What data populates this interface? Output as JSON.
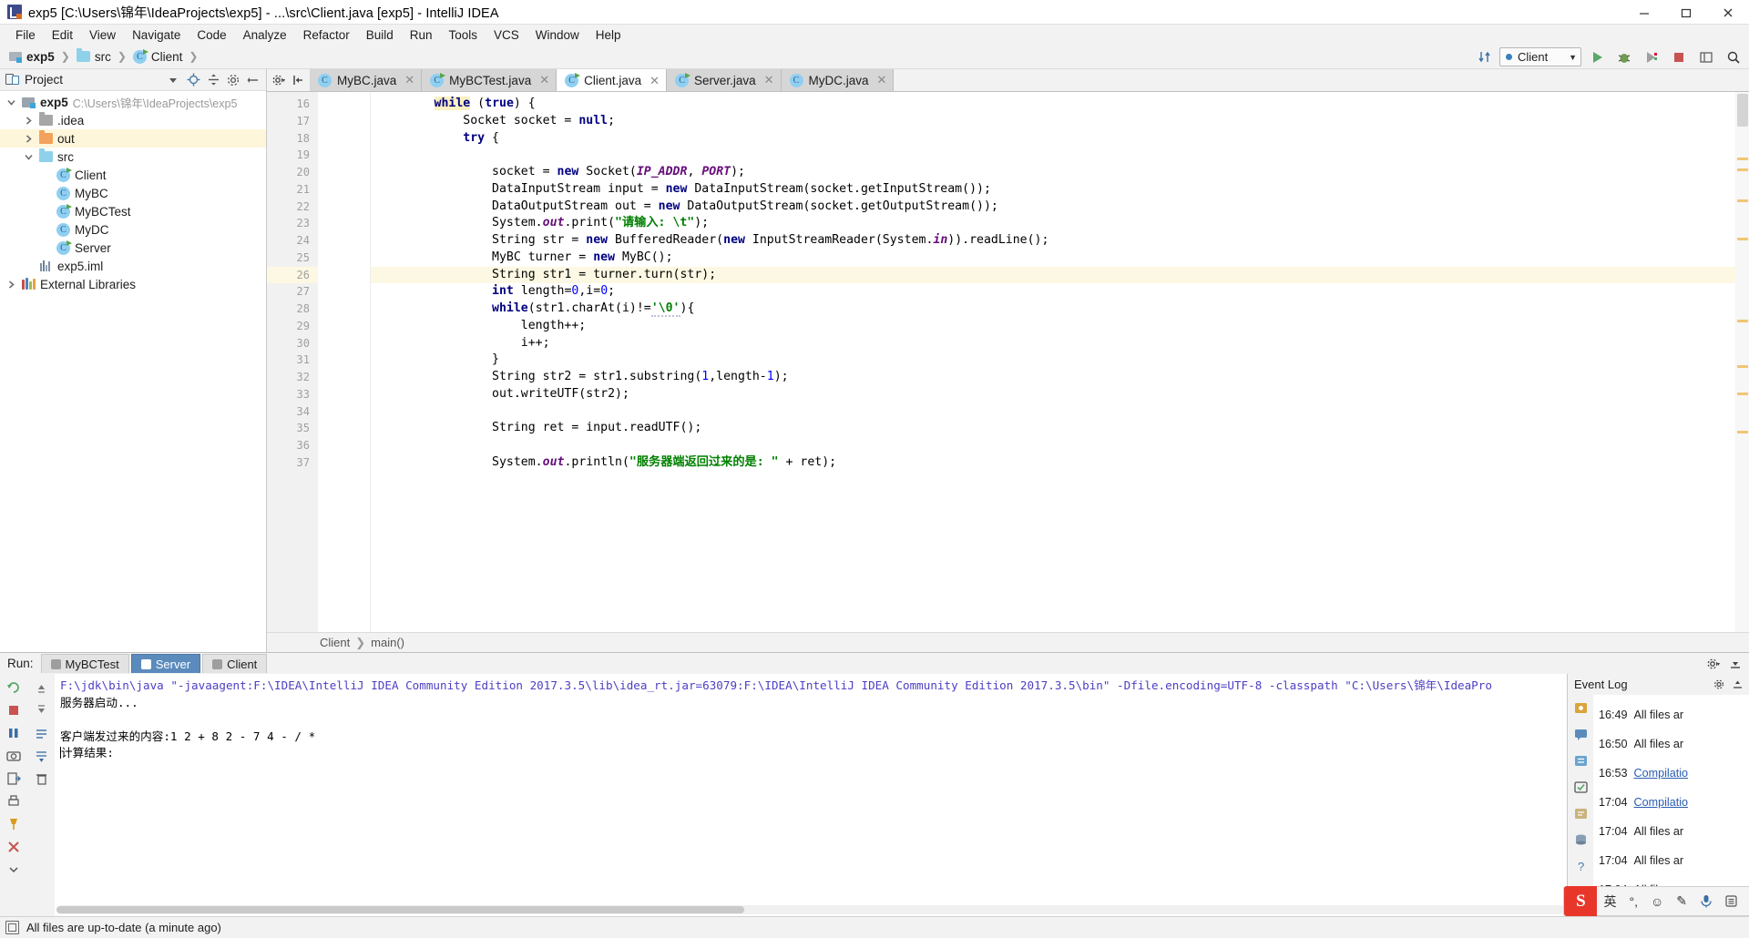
{
  "window": {
    "title": "exp5 [C:\\Users\\锦年\\IdeaProjects\\exp5] - ...\\src\\Client.java [exp5] - IntelliJ IDEA",
    "minimize_label": "Minimize",
    "maximize_label": "Maximize",
    "close_label": "Close"
  },
  "menubar": {
    "items": [
      {
        "label": "File"
      },
      {
        "label": "Edit"
      },
      {
        "label": "View"
      },
      {
        "label": "Navigate"
      },
      {
        "label": "Code"
      },
      {
        "label": "Analyze"
      },
      {
        "label": "Refactor"
      },
      {
        "label": "Build"
      },
      {
        "label": "Run"
      },
      {
        "label": "Tools"
      },
      {
        "label": "VCS"
      },
      {
        "label": "Window"
      },
      {
        "label": "Help"
      }
    ]
  },
  "navbar": {
    "crumbs": [
      {
        "label": "exp5",
        "icon": "module-icon"
      },
      {
        "label": "src",
        "icon": "folder-icon"
      },
      {
        "label": "Client",
        "icon": "java-class-icon"
      }
    ],
    "run_config": "Client",
    "run_tooltip": "Run",
    "debug_tooltip": "Debug",
    "coverage_tooltip": "Run with Coverage",
    "stop_tooltip": "Stop",
    "sync_tooltip": "Synchronize",
    "search_tooltip": "Search Everywhere"
  },
  "project_panel": {
    "title": "Project",
    "tree": [
      {
        "label": "exp5",
        "secondary": "C:\\Users\\锦年\\IdeaProjects\\exp5",
        "icon": "module-icon",
        "arrow": "down",
        "indent": 0,
        "bold": true,
        "selected": false
      },
      {
        "label": ".idea",
        "secondary": "",
        "icon": "folder-gray-icon",
        "arrow": "right",
        "indent": 1,
        "bold": false,
        "selected": false
      },
      {
        "label": "out",
        "secondary": "",
        "icon": "folder-orange-icon",
        "arrow": "right",
        "indent": 1,
        "bold": false,
        "selected": true
      },
      {
        "label": "src",
        "secondary": "",
        "icon": "folder-blue-icon",
        "arrow": "down",
        "indent": 1,
        "bold": false,
        "selected": false
      },
      {
        "label": "Client",
        "secondary": "",
        "icon": "java-class-runnable-icon",
        "arrow": "none",
        "indent": 2,
        "bold": false,
        "selected": false
      },
      {
        "label": "MyBC",
        "secondary": "",
        "icon": "java-class-icon",
        "arrow": "none",
        "indent": 2,
        "bold": false,
        "selected": false
      },
      {
        "label": "MyBCTest",
        "secondary": "",
        "icon": "java-class-runnable-icon",
        "arrow": "none",
        "indent": 2,
        "bold": false,
        "selected": false
      },
      {
        "label": "MyDC",
        "secondary": "",
        "icon": "java-class-icon",
        "arrow": "none",
        "indent": 2,
        "bold": false,
        "selected": false
      },
      {
        "label": "Server",
        "secondary": "",
        "icon": "java-class-runnable-icon",
        "arrow": "none",
        "indent": 2,
        "bold": false,
        "selected": false
      },
      {
        "label": "exp5.iml",
        "secondary": "",
        "icon": "iml-file-icon",
        "arrow": "none",
        "indent": 1,
        "bold": false,
        "selected": false
      },
      {
        "label": "External Libraries",
        "secondary": "",
        "icon": "library-icon",
        "arrow": "right",
        "indent": 0,
        "bold": false,
        "selected": false
      }
    ]
  },
  "editor": {
    "tabs": [
      {
        "label": "MyBC.java",
        "icon": "java-class-icon",
        "active": false
      },
      {
        "label": "MyBCTest.java",
        "icon": "java-class-runnable-icon",
        "active": false
      },
      {
        "label": "Client.java",
        "icon": "java-class-runnable-icon",
        "active": true
      },
      {
        "label": "Server.java",
        "icon": "java-class-runnable-icon",
        "active": false
      },
      {
        "label": "MyDC.java",
        "icon": "java-class-icon",
        "active": false
      }
    ],
    "first_line_number": 16,
    "current_line": 26,
    "lines": [
      {
        "n": 16,
        "tokens": [
          {
            "t": "        ",
            "c": ""
          },
          {
            "t": "while",
            "c": "kw hl"
          },
          {
            "t": " (",
            "c": ""
          },
          {
            "t": "true",
            "c": "kw"
          },
          {
            "t": ") {",
            "c": ""
          }
        ]
      },
      {
        "n": 17,
        "tokens": [
          {
            "t": "            Socket socket = ",
            "c": ""
          },
          {
            "t": "null",
            "c": "kw"
          },
          {
            "t": ";",
            "c": ""
          }
        ]
      },
      {
        "n": 18,
        "tokens": [
          {
            "t": "            ",
            "c": ""
          },
          {
            "t": "try",
            "c": "kw"
          },
          {
            "t": " {",
            "c": ""
          }
        ]
      },
      {
        "n": 19,
        "tokens": []
      },
      {
        "n": 20,
        "tokens": [
          {
            "t": "                socket = ",
            "c": ""
          },
          {
            "t": "new",
            "c": "kw"
          },
          {
            "t": " Socket(",
            "c": ""
          },
          {
            "t": "IP_ADDR",
            "c": "field"
          },
          {
            "t": ", ",
            "c": ""
          },
          {
            "t": "PORT",
            "c": "field"
          },
          {
            "t": ");",
            "c": ""
          }
        ]
      },
      {
        "n": 21,
        "tokens": [
          {
            "t": "                DataInputStream input = ",
            "c": ""
          },
          {
            "t": "new",
            "c": "kw"
          },
          {
            "t": " DataInputStream(socket.getInputStream());",
            "c": ""
          }
        ]
      },
      {
        "n": 22,
        "tokens": [
          {
            "t": "                DataOutputStream out = ",
            "c": ""
          },
          {
            "t": "new",
            "c": "kw"
          },
          {
            "t": " DataOutputStream(socket.getOutputStream());",
            "c": ""
          }
        ]
      },
      {
        "n": 23,
        "tokens": [
          {
            "t": "                System.",
            "c": ""
          },
          {
            "t": "out",
            "c": "field"
          },
          {
            "t": ".print(",
            "c": ""
          },
          {
            "t": "\"请输入: \\t\"",
            "c": "str"
          },
          {
            "t": ");",
            "c": ""
          }
        ]
      },
      {
        "n": 24,
        "tokens": [
          {
            "t": "                String str = ",
            "c": ""
          },
          {
            "t": "new",
            "c": "kw"
          },
          {
            "t": " BufferedReader(",
            "c": ""
          },
          {
            "t": "new",
            "c": "kw"
          },
          {
            "t": " InputStreamReader(System.",
            "c": ""
          },
          {
            "t": "in",
            "c": "field"
          },
          {
            "t": ")).readLine();",
            "c": ""
          }
        ]
      },
      {
        "n": 25,
        "tokens": [
          {
            "t": "                MyBC turner = ",
            "c": ""
          },
          {
            "t": "new",
            "c": "kw"
          },
          {
            "t": " MyBC();",
            "c": ""
          }
        ]
      },
      {
        "n": 26,
        "tokens": [
          {
            "t": "                String str1 = turner.turn(str);",
            "c": ""
          }
        ]
      },
      {
        "n": 27,
        "tokens": [
          {
            "t": "                ",
            "c": ""
          },
          {
            "t": "int",
            "c": "kw"
          },
          {
            "t": " length=",
            "c": ""
          },
          {
            "t": "0",
            "c": "num"
          },
          {
            "t": ",i=",
            "c": ""
          },
          {
            "t": "0",
            "c": "num"
          },
          {
            "t": ";",
            "c": ""
          }
        ]
      },
      {
        "n": 28,
        "tokens": [
          {
            "t": "                ",
            "c": ""
          },
          {
            "t": "while",
            "c": "kw"
          },
          {
            "t": "(str1.charAt(i)!=",
            "c": ""
          },
          {
            "t": "'\\0'",
            "c": "str errmark"
          },
          {
            "t": "){",
            "c": ""
          }
        ]
      },
      {
        "n": 29,
        "tokens": [
          {
            "t": "                    length++;",
            "c": ""
          }
        ]
      },
      {
        "n": 30,
        "tokens": [
          {
            "t": "                    i++;",
            "c": ""
          }
        ]
      },
      {
        "n": 31,
        "tokens": [
          {
            "t": "                }",
            "c": ""
          }
        ]
      },
      {
        "n": 32,
        "tokens": [
          {
            "t": "                String str2 = str1.substring(",
            "c": ""
          },
          {
            "t": "1",
            "c": "num"
          },
          {
            "t": ",length-",
            "c": ""
          },
          {
            "t": "1",
            "c": "num"
          },
          {
            "t": ");",
            "c": ""
          }
        ]
      },
      {
        "n": 33,
        "tokens": [
          {
            "t": "                out.writeUTF(str2);",
            "c": ""
          }
        ]
      },
      {
        "n": 34,
        "tokens": []
      },
      {
        "n": 35,
        "tokens": [
          {
            "t": "                String ret = input.readUTF();",
            "c": ""
          }
        ]
      },
      {
        "n": 36,
        "tokens": []
      },
      {
        "n": 37,
        "tokens": [
          {
            "t": "                System.",
            "c": ""
          },
          {
            "t": "out",
            "c": "field"
          },
          {
            "t": ".println(",
            "c": ""
          },
          {
            "t": "\"服务器端返回过来的是: \"",
            "c": "str"
          },
          {
            "t": " + ret);",
            "c": ""
          }
        ]
      }
    ],
    "breadcrumb": {
      "class": "Client",
      "method": "main()"
    }
  },
  "run_window": {
    "label": "Run:",
    "tabs": [
      {
        "label": "MyBCTest",
        "active": false
      },
      {
        "label": "Server",
        "active": true
      },
      {
        "label": "Client",
        "active": false
      }
    ],
    "console": [
      {
        "text": "F:\\jdk\\bin\\java \"-javaagent:F:\\IDEA\\IntelliJ IDEA Community Edition 2017.3.5\\lib\\idea_rt.jar=63079:F:\\IDEA\\IntelliJ IDEA Community Edition 2017.3.5\\bin\" -Dfile.encoding=UTF-8 -classpath \"C:\\Users\\锦年\\IdeaPro",
        "kind": "cmd"
      },
      {
        "text": "服务器启动...",
        "kind": "out"
      },
      {
        "text": "",
        "kind": "out"
      },
      {
        "text": "客户端发过来的内容:1 2 + 8 2 - 7 4 - / *",
        "kind": "out"
      },
      {
        "text": "计算结果:",
        "kind": "out"
      }
    ],
    "gutter_buttons": [
      {
        "name": "rerun-icon"
      },
      {
        "name": "stop-icon"
      },
      {
        "name": "pause-icon"
      },
      {
        "name": "camera-icon"
      },
      {
        "name": "export-icon"
      },
      {
        "name": "print-icon"
      },
      {
        "name": "pin-icon"
      },
      {
        "name": "close-icon"
      },
      {
        "name": "expand-icon"
      }
    ],
    "gutter2_buttons": [
      {
        "name": "scroll-up-icon"
      },
      {
        "name": "scroll-down-icon"
      },
      {
        "name": "soft-wrap-icon"
      },
      {
        "name": "scroll-to-end-icon"
      },
      {
        "name": "clear-all-icon"
      }
    ]
  },
  "event_log": {
    "title": "Event Log",
    "entries": [
      {
        "time": "16:49",
        "text": "All files ar",
        "link": false
      },
      {
        "time": "16:50",
        "text": "All files ar",
        "link": false
      },
      {
        "time": "16:53",
        "text": "Compilatio",
        "link": true
      },
      {
        "time": "17:04",
        "text": "Compilatio",
        "link": true
      },
      {
        "time": "17:04",
        "text": "All files ar",
        "link": false
      },
      {
        "time": "17:04",
        "text": "All files ar",
        "link": false
      },
      {
        "time": "17:04",
        "text": "All files ar",
        "link": false
      }
    ],
    "side_icons": [
      {
        "name": "tools-icon"
      },
      {
        "name": "message-icon"
      },
      {
        "name": "structure-icon"
      },
      {
        "name": "build-icon"
      },
      {
        "name": "todo-icon"
      },
      {
        "name": "database-icon"
      },
      {
        "name": "help-icon"
      }
    ]
  },
  "statusbar": {
    "message": "All files are up-to-date (a minute ago)"
  },
  "ime": {
    "logo": "S",
    "mode": "英",
    "punct": "°,",
    "items": [
      {
        "name": "emoji-icon",
        "glyph": "☺"
      },
      {
        "name": "pen-icon",
        "glyph": "✎"
      },
      {
        "name": "mic-icon",
        "glyph": "🎤"
      },
      {
        "name": "menu-icon",
        "glyph": "▤"
      }
    ]
  },
  "colors": {
    "accent": "#5b8bbd",
    "keyword": "#000082",
    "string": "#008000",
    "number": "#0000ff",
    "field": "#660e7a",
    "current_line": "#fcf8e3",
    "selection": "#fdf6da"
  }
}
